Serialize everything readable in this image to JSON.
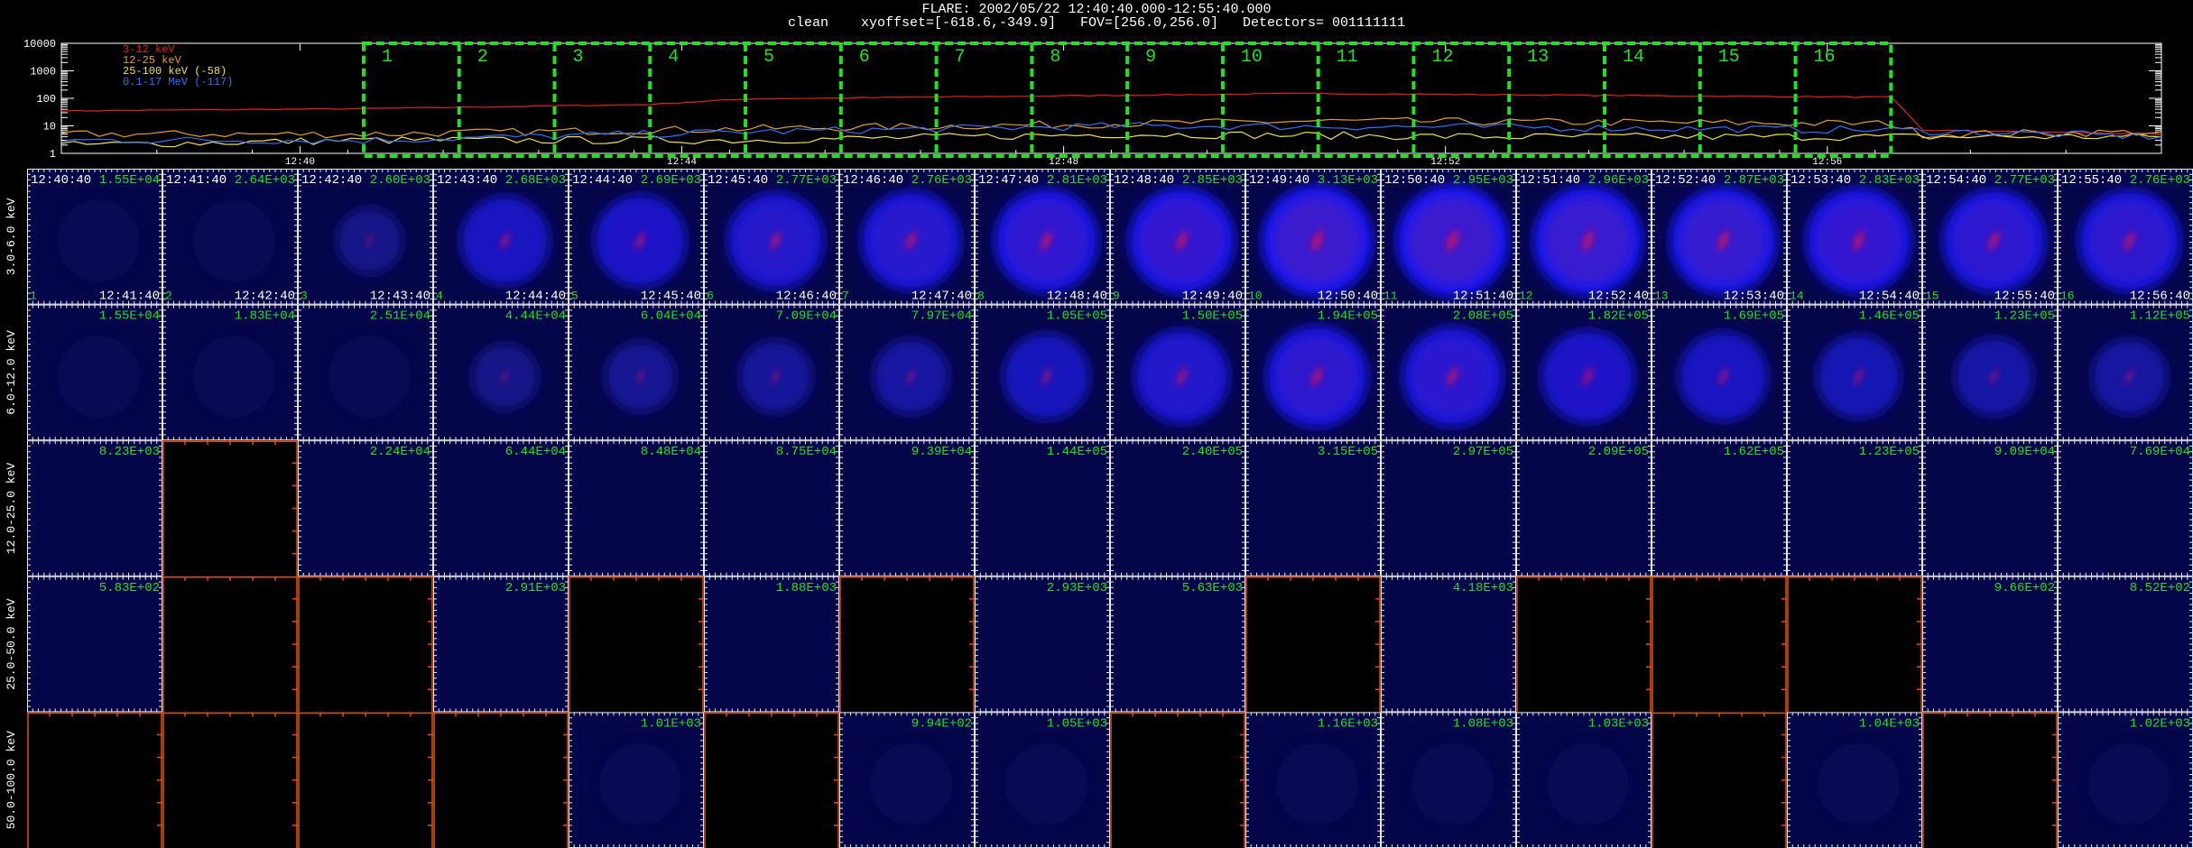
{
  "header": {
    "title": "FLARE: 2002/05/22 12:40:40.000-12:55:40.000",
    "subtitle": "clean    xyoffset=[-618.6,-349.9]   FOV=[256.0,256.0]   Detectors= 001111111"
  },
  "lightcurve": {
    "ytick_labels": [
      "10000",
      "1000",
      "100",
      "10",
      "1"
    ],
    "ytick_values": [
      10000,
      1000,
      100,
      10,
      1
    ],
    "xtick_labels": [
      "12:40",
      "12:44",
      "12:48",
      "12:52",
      "12:56"
    ],
    "legend": [
      {
        "label": "3-12 keV",
        "color": "#e02020"
      },
      {
        "label": "12-25 keV",
        "color": "#e0a020"
      },
      {
        "label": "25-100 keV (-58)",
        "color": "#f0e040"
      },
      {
        "label": "0.1-17 MeV (-117)",
        "color": "#3070ff"
      }
    ],
    "interval_numbers": [
      "1",
      "2",
      "3",
      "4",
      "5",
      "6",
      "7",
      "8",
      "9",
      "10",
      "11",
      "12",
      "13",
      "14",
      "15",
      "16"
    ],
    "interval_color": "#22e022"
  },
  "chart_data": {
    "type": "line",
    "yscale": "log",
    "ylim": [
      1,
      10000
    ],
    "xlim": [
      "12:37:30",
      "12:59:30"
    ],
    "grid": false,
    "legend_position": "top-left",
    "series": [
      {
        "name": "3-12 keV",
        "color": "#e02020",
        "x": [
          "12:37:30",
          "12:40:40",
          "12:43:40",
          "12:44:40",
          "12:48:40",
          "12:50:40",
          "12:55:40",
          "12:56:40",
          "12:57:00",
          "12:59:30"
        ],
        "values": [
          35,
          42,
          60,
          95,
          130,
          150,
          115,
          110,
          7,
          5
        ]
      },
      {
        "name": "12-25 keV",
        "color": "#e0a020",
        "x": [
          "12:37:30",
          "12:40:40",
          "12:43:40",
          "12:48:40",
          "12:50:40",
          "12:56:40",
          "12:57:00",
          "12:59:30"
        ],
        "values": [
          5,
          5,
          7,
          12,
          15,
          12,
          5,
          6
        ]
      },
      {
        "name": "25-100 keV (-58)",
        "color": "#f0e040",
        "x": [
          "12:37:30",
          "12:40:40",
          "12:44:40",
          "12:48:40",
          "12:52:40",
          "12:56:40",
          "12:59:30"
        ],
        "values": [
          2,
          3,
          3,
          5,
          4,
          4,
          4
        ]
      },
      {
        "name": "0.1-17 MeV (-117)",
        "color": "#3070ff",
        "x": [
          "12:37:30",
          "12:40:40",
          "12:44:40",
          "12:48:40",
          "12:52:40",
          "12:56:40",
          "12:59:30"
        ],
        "values": [
          3,
          3,
          6,
          10,
          9,
          7,
          4
        ]
      }
    ]
  },
  "grid": {
    "energy_labels": [
      "3.0-6.0 keV",
      "6.0-12.0 keV",
      "12.0-25.0 keV",
      "25.0-50.0 keV",
      "50.0-100.0 keV"
    ],
    "start_times": [
      "12:40:40",
      "12:41:40",
      "12:42:40",
      "12:43:40",
      "12:44:40",
      "12:45:40",
      "12:46:40",
      "12:47:40",
      "12:48:40",
      "12:49:40",
      "12:50:40",
      "12:51:40",
      "12:52:40",
      "12:53:40",
      "12:54:40",
      "12:55:40"
    ],
    "end_times": [
      "12:41:40",
      "12:42:40",
      "12:43:40",
      "12:44:40",
      "12:45:40",
      "12:46:40",
      "12:47:40",
      "12:48:40",
      "12:49:40",
      "12:50:40",
      "12:51:40",
      "12:52:40",
      "12:53:40",
      "12:54:40",
      "12:55:40",
      "12:56:40"
    ],
    "index_labels": [
      "1",
      "2",
      "3",
      "4",
      "5",
      "6",
      "7",
      "8",
      "9",
      "10",
      "11",
      "12",
      "13",
      "14",
      "15",
      "16"
    ],
    "max_labels": [
      [
        "1.55E+04",
        "2.64E+03",
        "2.60E+03",
        "2.68E+03",
        "2.69E+03",
        "2.77E+03",
        "2.76E+03",
        "2.81E+03",
        "2.85E+03",
        "3.13E+03",
        "2.95E+03",
        "2.96E+03",
        "2.87E+03",
        "2.83E+03",
        "2.77E+03",
        "2.76E+03"
      ],
      [
        "1.55E+04",
        "1.83E+04",
        "2.51E+04",
        "4.44E+04",
        "6.04E+04",
        "7.09E+04",
        "7.97E+04",
        "1.05E+05",
        "1.50E+05",
        "1.94E+05",
        "2.08E+05",
        "1.82E+05",
        "1.69E+05",
        "1.46E+05",
        "1.23E+05",
        "1.12E+05"
      ],
      [
        "8.23E+03",
        "",
        "2.24E+04",
        "6.44E+04",
        "8.48E+04",
        "8.75E+04",
        "9.39E+04",
        "1.44E+05",
        "2.40E+05",
        "3.15E+05",
        "2.97E+05",
        "2.09E+05",
        "1.62E+05",
        "1.23E+05",
        "9.09E+04",
        "7.69E+04"
      ],
      [
        "5.83E+02",
        "",
        "",
        "2.91E+03",
        "",
        "1.88E+03",
        "",
        "2.93E+03",
        "5.63E+03",
        "",
        "4.18E+03",
        "",
        "",
        "",
        "9.66E+02",
        "8.52E+02"
      ],
      [
        "",
        "",
        "",
        "",
        "1.01E+03",
        "",
        "9.94E+02",
        "1.05E+03",
        "",
        "1.16E+03",
        "1.08E+03",
        "1.03E+03",
        "",
        "1.04E+03",
        "",
        "1.02E+03"
      ]
    ],
    "cell_status": [
      [
        "image",
        "image",
        "image",
        "image",
        "image",
        "image",
        "image",
        "image",
        "image",
        "image",
        "image",
        "image",
        "image",
        "image",
        "image",
        "image"
      ],
      [
        "image",
        "image",
        "image",
        "image",
        "image",
        "image",
        "image",
        "image",
        "image",
        "image",
        "image",
        "image",
        "image",
        "image",
        "image",
        "image"
      ],
      [
        "image",
        "empty",
        "image",
        "image",
        "image",
        "image",
        "image",
        "image",
        "image",
        "image",
        "image",
        "image",
        "image",
        "image",
        "image",
        "image"
      ],
      [
        "image",
        "empty",
        "empty",
        "image",
        "empty",
        "image",
        "empty",
        "image",
        "image",
        "empty",
        "image",
        "empty",
        "empty",
        "empty",
        "image",
        "image"
      ],
      [
        "empty",
        "empty",
        "empty",
        "empty",
        "image",
        "empty",
        "image",
        "image",
        "empty",
        "image",
        "image",
        "image",
        "empty",
        "image",
        "empty",
        "image"
      ]
    ],
    "intensity": [
      [
        0.04,
        0.08,
        0.12,
        0.55,
        0.6,
        0.68,
        0.74,
        0.82,
        0.86,
        0.95,
        0.97,
        0.92,
        0.88,
        0.85,
        0.8,
        0.78
      ],
      [
        0.02,
        0.03,
        0.05,
        0.12,
        0.2,
        0.25,
        0.3,
        0.5,
        0.65,
        0.78,
        0.75,
        0.62,
        0.55,
        0.45,
        0.35,
        0.3
      ],
      [
        0.0,
        0.0,
        0.0,
        0.0,
        0.0,
        0.0,
        0.0,
        0.0,
        0.0,
        0.0,
        0.0,
        0.0,
        0.0,
        0.0,
        0.0,
        0.0
      ],
      [
        0.0,
        0.0,
        0.0,
        0.0,
        0.0,
        0.0,
        0.0,
        0.0,
        0.0,
        0.0,
        0.0,
        0.0,
        0.0,
        0.0,
        0.0,
        0.0
      ],
      [
        0.0,
        0.0,
        0.0,
        0.0,
        0.05,
        0.0,
        0.05,
        0.05,
        0.0,
        0.05,
        0.05,
        0.05,
        0.0,
        0.05,
        0.0,
        0.05
      ]
    ],
    "label_color": "#22e022",
    "empty_tick_color": "#e05010"
  }
}
